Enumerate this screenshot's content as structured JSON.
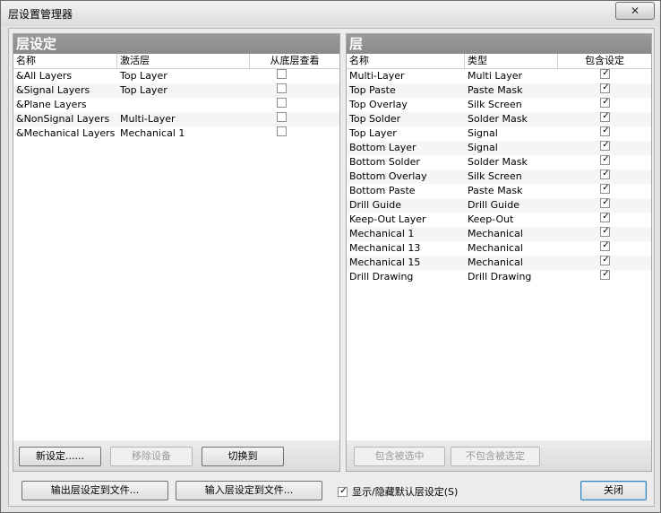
{
  "window": {
    "title": "层设置管理器",
    "close_glyph": "✕"
  },
  "left_panel": {
    "title": "层设定",
    "columns": [
      "名称",
      "激活层",
      "从底层查看"
    ],
    "rows": [
      {
        "name": "&All Layers",
        "active": "Top Layer",
        "bottom_view": false
      },
      {
        "name": "&Signal Layers",
        "active": "Top Layer",
        "bottom_view": false
      },
      {
        "name": "&Plane Layers",
        "active": "",
        "bottom_view": false
      },
      {
        "name": "&NonSignal Layers",
        "active": "Multi-Layer",
        "bottom_view": false
      },
      {
        "name": "&Mechanical Layers",
        "active": "Mechanical 1",
        "bottom_view": false
      }
    ],
    "buttons": {
      "new": "新设定......",
      "remove": "移除设备",
      "switch": "切换到"
    }
  },
  "right_panel": {
    "title": "层",
    "columns": [
      "名称",
      "类型",
      "包含设定"
    ],
    "rows": [
      {
        "name": "Multi-Layer",
        "type": "Multi Layer",
        "included": true
      },
      {
        "name": "Top Paste",
        "type": "Paste Mask",
        "included": true
      },
      {
        "name": "Top Overlay",
        "type": "Silk Screen",
        "included": true
      },
      {
        "name": "Top Solder",
        "type": "Solder Mask",
        "included": true
      },
      {
        "name": "Top Layer",
        "type": "Signal",
        "included": true
      },
      {
        "name": "Bottom Layer",
        "type": "Signal",
        "included": true
      },
      {
        "name": "Bottom Solder",
        "type": "Solder Mask",
        "included": true
      },
      {
        "name": "Bottom Overlay",
        "type": "Silk Screen",
        "included": true
      },
      {
        "name": "Bottom Paste",
        "type": "Paste Mask",
        "included": true
      },
      {
        "name": "Drill Guide",
        "type": "Drill Guide",
        "included": true
      },
      {
        "name": "Keep-Out Layer",
        "type": "Keep-Out",
        "included": true
      },
      {
        "name": "Mechanical 1",
        "type": "Mechanical",
        "included": true
      },
      {
        "name": "Mechanical 13",
        "type": "Mechanical",
        "included": true
      },
      {
        "name": "Mechanical 15",
        "type": "Mechanical",
        "included": true
      },
      {
        "name": "Drill Drawing",
        "type": "Drill Drawing",
        "included": true
      }
    ],
    "buttons": {
      "include_selected": "包含被选中",
      "exclude_selected": "不包含被选定"
    }
  },
  "bottom": {
    "export": "输出层设定到文件...",
    "import": "输入层设定到文件...",
    "show_hide": "显示/隐藏默认层设定(S)",
    "show_hide_checked": true,
    "close": "关闭"
  }
}
